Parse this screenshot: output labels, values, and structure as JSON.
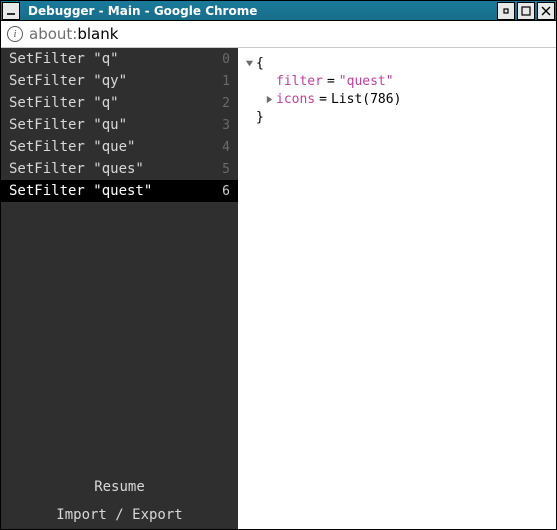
{
  "window": {
    "title": "Debugger - Main - Google Chrome"
  },
  "addressbar": {
    "protocol": "about:",
    "path": "blank"
  },
  "sidebar": {
    "history": [
      {
        "label": "SetFilter \"q\"",
        "index": "0",
        "selected": false
      },
      {
        "label": "SetFilter \"qy\"",
        "index": "1",
        "selected": false
      },
      {
        "label": "SetFilter \"q\"",
        "index": "2",
        "selected": false
      },
      {
        "label": "SetFilter \"qu\"",
        "index": "3",
        "selected": false
      },
      {
        "label": "SetFilter \"que\"",
        "index": "4",
        "selected": false
      },
      {
        "label": "SetFilter \"ques\"",
        "index": "5",
        "selected": false
      },
      {
        "label": "SetFilter \"quest\"",
        "index": "6",
        "selected": true
      }
    ],
    "resume_label": "Resume",
    "import_export_label": "Import / Export"
  },
  "inspector": {
    "open_brace": "{",
    "close_brace": "}",
    "fields": {
      "filter": {
        "key": "filter",
        "eq": "=",
        "value": "\"quest\""
      },
      "icons": {
        "key": "icons",
        "eq": "=",
        "value_prefix": "List(",
        "value_num": "786",
        "value_suffix": ")"
      }
    }
  }
}
